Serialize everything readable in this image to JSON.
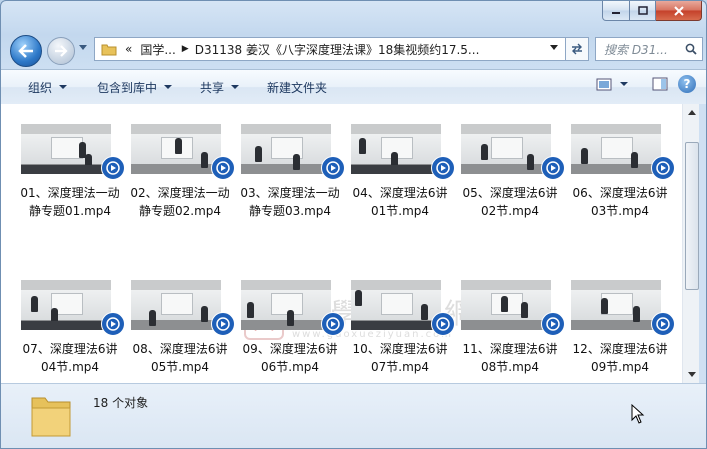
{
  "window": {
    "caption_buttons": {
      "minimize_icon": "minimize-icon",
      "maximize_icon": "maximize-icon",
      "close_icon": "close-icon"
    }
  },
  "address": {
    "overflow": "«",
    "crumbs": [
      "国学...",
      "D31138 姜汉《八字深度理法课》18集视频约17.5..."
    ],
    "search_placeholder": "搜索 D31..."
  },
  "toolbar": {
    "organize": "组织",
    "include_library": "包含到库中",
    "share": "共享",
    "new_folder": "新建文件夹"
  },
  "files": [
    {
      "name": "01、深度理法一动静专题01.mp4"
    },
    {
      "name": "02、深度理法一动静专题02.mp4"
    },
    {
      "name": "03、深度理法一动静专题03.mp4"
    },
    {
      "name": "04、深度理法6讲01节.mp4"
    },
    {
      "name": "05、深度理法6讲02节.mp4"
    },
    {
      "name": "06、深度理法6讲03节.mp4"
    },
    {
      "name": "07、深度理法6讲04节.mp4"
    },
    {
      "name": "08、深度理法6讲05节.mp4"
    },
    {
      "name": "09、深度理法6讲06节.mp4"
    },
    {
      "name": "10、深度理法6讲07节.mp4"
    },
    {
      "name": "11、深度理法6讲08节.mp4"
    },
    {
      "name": "12、深度理法6讲09节.mp4"
    }
  ],
  "watermark": {
    "text": "國學資源網",
    "url": "www.guoxueziyuan.com",
    "seal": "國"
  },
  "status": {
    "count": "18 个对象"
  },
  "colors": {
    "accent": "#1e5fb8",
    "toolbar_text": "#1e3960"
  }
}
